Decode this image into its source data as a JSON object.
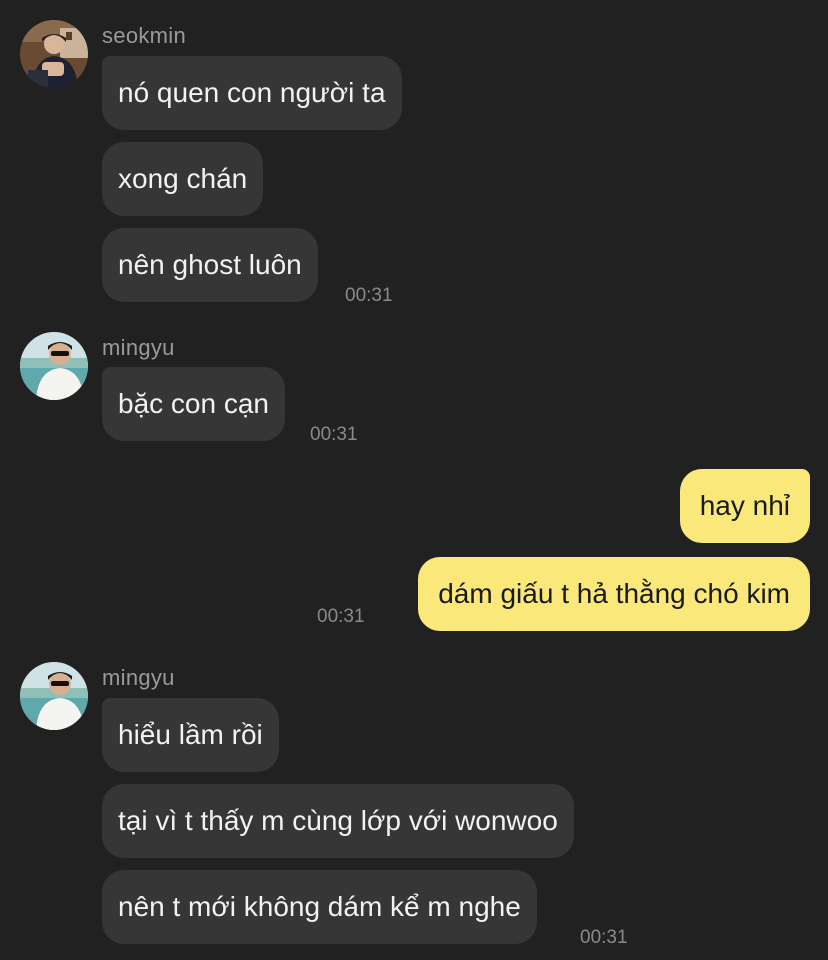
{
  "groups": [
    {
      "sender": "seokmin",
      "avatar_icon": "seokmin-profile-photo",
      "messages": [
        "nó quen con người ta",
        "xong chán",
        "nên ghost luôn"
      ],
      "time": "00:31"
    },
    {
      "sender": "mingyu",
      "avatar_icon": "mingyu-profile-photo",
      "messages": [
        "bặc con cạn"
      ],
      "time": "00:31"
    },
    {
      "sender": "",
      "outgoing": true,
      "messages": [
        "hay nhỉ",
        "dám giấu t hả thằng chó kim"
      ],
      "time": "00:31"
    },
    {
      "sender": "mingyu",
      "avatar_icon": "mingyu-profile-photo",
      "messages": [
        "hiểu lầm rồi",
        "tại vì t thấy m cùng lớp với wonwoo",
        "nên t mới không dám kể m nghe"
      ],
      "time": "00:31"
    }
  ],
  "colors": {
    "background": "#212121",
    "incoming_bubble": "#363636",
    "outgoing_bubble": "#fae97a",
    "sender_name": "#9a9a9a",
    "timestamp": "#8a8a8a"
  }
}
